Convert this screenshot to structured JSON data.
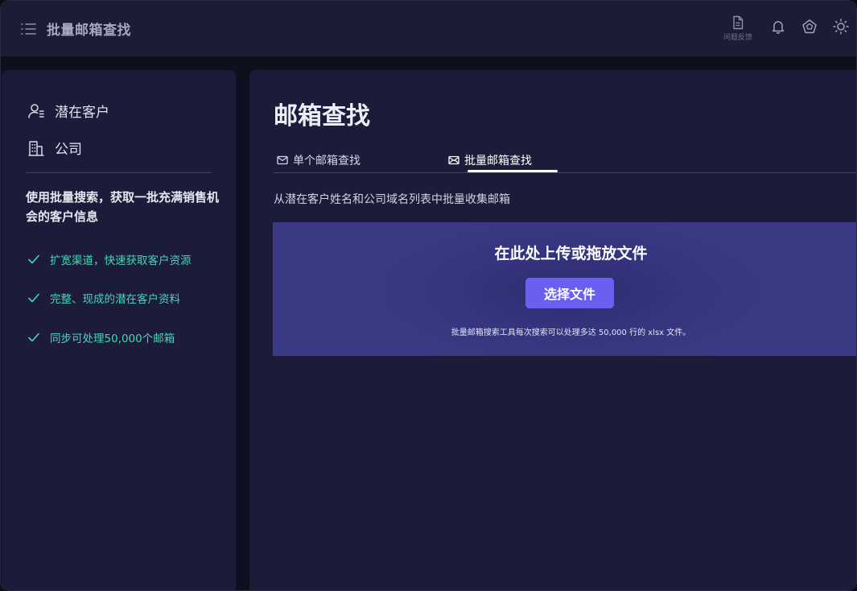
{
  "header": {
    "title": "批量邮箱查找",
    "feedback_label": "问题反馈",
    "icons": [
      "menu-icon",
      "document-icon",
      "bell-icon",
      "badge-icon",
      "sun-icon"
    ]
  },
  "sidebar": {
    "nav": [
      {
        "label": "潜在客户",
        "icon": "user-list-icon"
      },
      {
        "label": "公司",
        "icon": "building-icon"
      }
    ],
    "promo": "使用批量搜索，获取一批充满销售机会的客户信息",
    "features": [
      "扩宽渠道，快速获取客户资源",
      "完整、现成的潜在客户资料",
      "同步可处理50,000个邮箱"
    ],
    "feature_color": "#45d6b6"
  },
  "main": {
    "title": "邮箱查找",
    "tabs": [
      {
        "label": "单个邮箱查找",
        "icon": "mail-icon",
        "active": false
      },
      {
        "label": "批量邮箱查找",
        "icon": "mail-open-icon",
        "active": true
      }
    ],
    "subtitle": "从潜在客户姓名和公司域名列表中批量收集邮箱",
    "dropzone": {
      "title": "在此处上传或拖放文件",
      "button_label": "选择文件",
      "note": "批量邮箱搜索工具每次搜索可以处理多达 50,000 行的 xlsx 文件。"
    }
  },
  "colors": {
    "accent": "#6a5ff0",
    "background": "#1c1c3a",
    "header": "#1c1c36"
  }
}
